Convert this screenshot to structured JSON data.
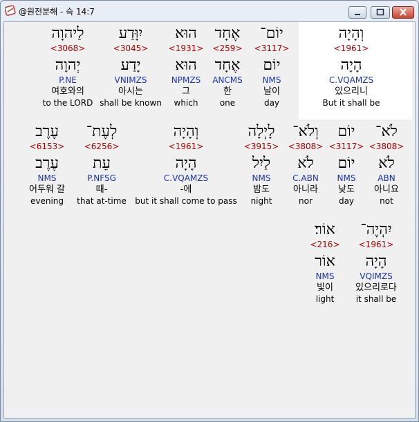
{
  "window": {
    "title": "@원전분해 - 슥 14:7",
    "controls": [
      "minimize",
      "maximize",
      "close"
    ]
  },
  "rows": [
    {
      "words": [
        {
          "heb": "לַיהוָה",
          "strong": "<3068>",
          "root": "יְהוָה",
          "morph": "P.NE",
          "kor": "여호와의",
          "eng": "to the LORD"
        },
        {
          "heb": "יִוָּדַע",
          "strong": "<3045>",
          "root": "יָדַע",
          "morph": "VNIMZS",
          "kor": "아시는",
          "eng": "shall be known"
        },
        {
          "heb": "הוּא",
          "strong": "<1931>",
          "root": "הוּא",
          "morph": "NPMZS",
          "kor": "그",
          "eng": "which"
        },
        {
          "heb": "אֶחָד",
          "strong": "<259>",
          "root": "אֶחָד",
          "morph": "ANCMS",
          "kor": "한",
          "eng": "one"
        },
        {
          "heb": "יוֹם־",
          "strong": "<3117>",
          "root": "יוֹם",
          "morph": "NMS",
          "kor": "날이",
          "eng": "day"
        },
        {
          "heb": "וְהָיָה",
          "strong": "<1961>",
          "root": "הָיָה",
          "morph": "C.VQAMZS",
          "kor": "있으리니",
          "eng": "But it shall be"
        }
      ]
    },
    {
      "words": [
        {
          "heb": "עֶרֶב",
          "strong": "<6153>",
          "root": "עֶרֶב",
          "morph": "NMS",
          "kor": "어두워 갈",
          "eng": "evening"
        },
        {
          "heb": "לְעֶת־",
          "strong": "<6256>",
          "root": "עֵת",
          "morph": "P.NFSG",
          "kor": "때-",
          "eng": "that at-time"
        },
        {
          "heb": "וְהָיָה",
          "strong": "<1961>",
          "root": "הָיָה",
          "morph": "C.VQAMZS",
          "kor": "-에",
          "eng": "but it shall come to pass"
        },
        {
          "heb": "לָיְלָה",
          "strong": "<3915>",
          "root": "לַיִל",
          "morph": "NMS",
          "kor": "밤도",
          "eng": "night"
        },
        {
          "heb": "וְלֹא־",
          "strong": "<3808>",
          "root": "לֹא",
          "morph": "C.ABN",
          "kor": "아니라",
          "eng": "nor"
        },
        {
          "heb": "יוֹם",
          "strong": "<3117>",
          "root": "יוֹם",
          "morph": "NMS",
          "kor": "낮도",
          "eng": "day"
        },
        {
          "heb": "לֹא־",
          "strong": "<3808>",
          "root": "לֹא",
          "morph": "ABN",
          "kor": "아니요",
          "eng": "not"
        }
      ]
    },
    {
      "words": [
        {
          "heb": "אוֹר׃",
          "strong": "<216>",
          "root": "אוֹר",
          "morph": "NMS",
          "kor": "빛이",
          "eng": "light"
        },
        {
          "heb": "יִהְיֶה־",
          "strong": "<1961>",
          "root": "הָיָה",
          "morph": "VQIMZS",
          "kor": "있으리로다",
          "eng": "it shall be"
        }
      ]
    }
  ]
}
